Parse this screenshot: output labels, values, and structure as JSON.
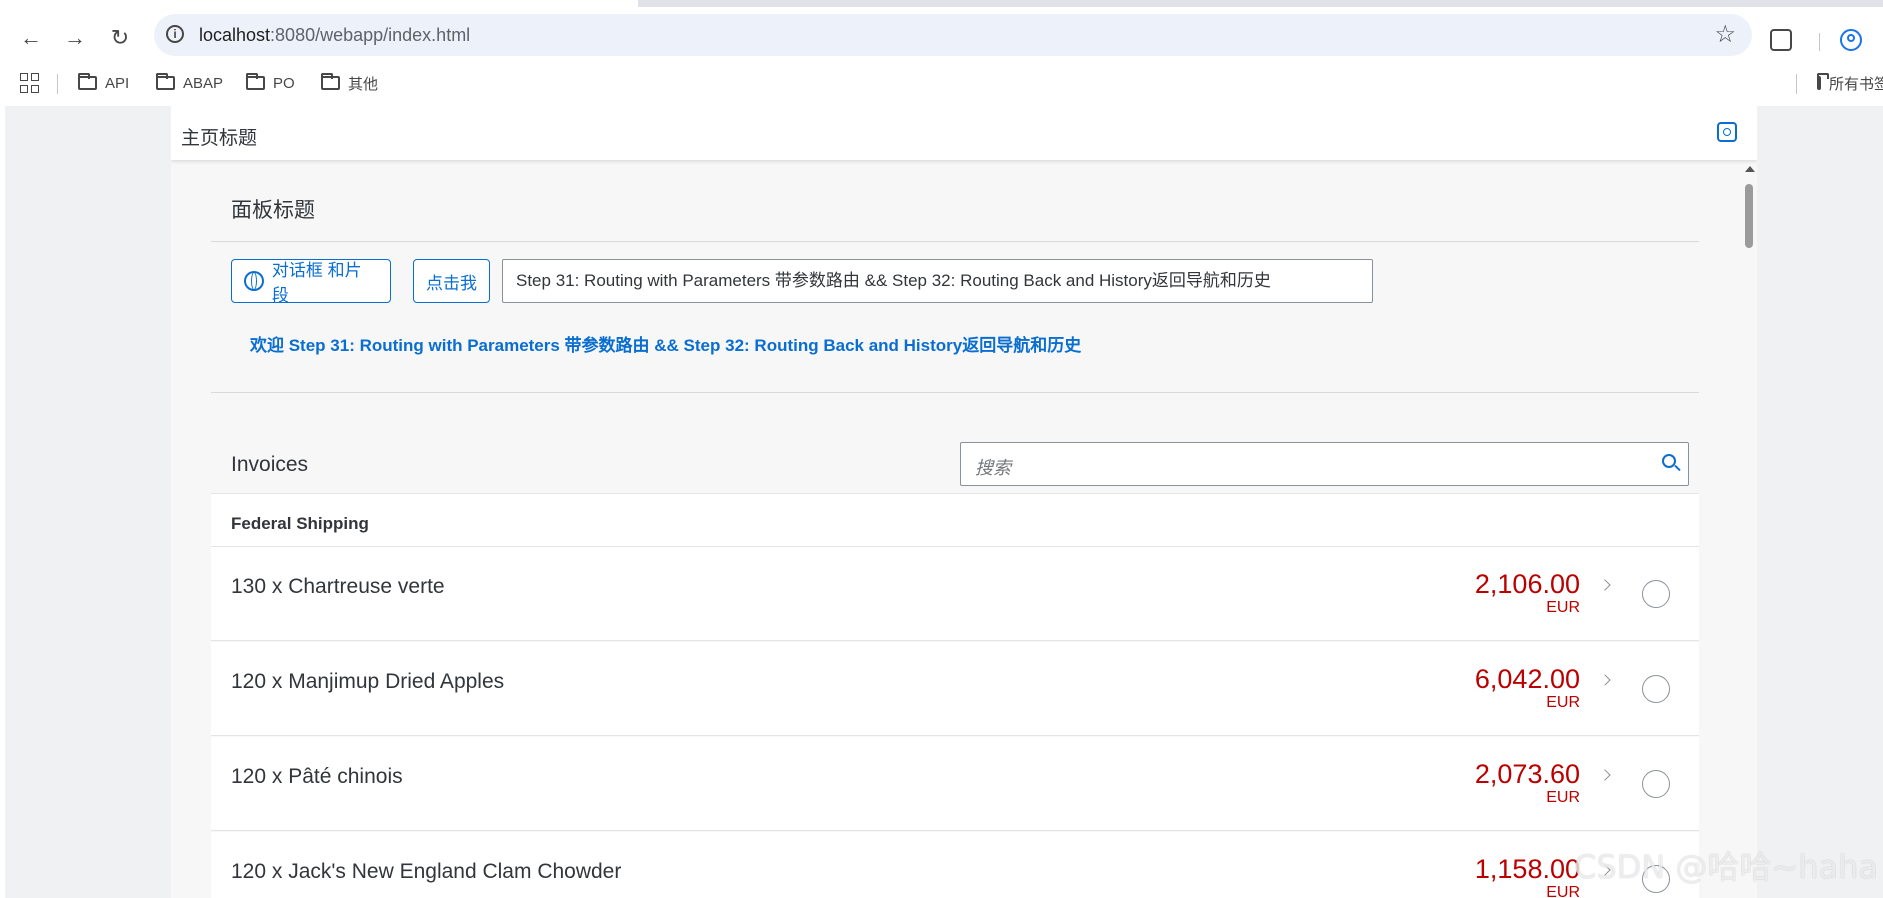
{
  "browser": {
    "url_host": "localhost",
    "url_path": ":8080/webapp/index.html",
    "bookmarks": [
      "API",
      "ABAP",
      "PO",
      "其他"
    ],
    "bookmarks_right": "所有书签"
  },
  "shell": {
    "title": "主页标题"
  },
  "panel": {
    "title": "面板标题",
    "dialog_button_label": "对话框 和片段",
    "click_button_label": "点击我",
    "name_input_value": "Step 31: Routing with Parameters 带参数路由 && Step 32: Routing Back and History返回导航和历史",
    "greeting": "欢迎 Step 31: Routing with Parameters 带参数路由 && Step 32: Routing Back and History返回导航和历史"
  },
  "invoices": {
    "title": "Invoices",
    "search_placeholder": "搜索",
    "group": "Federal Shipping",
    "items": [
      {
        "title": "130 x Chartreuse verte",
        "amount": "2,106.00",
        "currency": "EUR"
      },
      {
        "title": "120 x Manjimup Dried Apples",
        "amount": "6,042.00",
        "currency": "EUR"
      },
      {
        "title": "120 x Pâté chinois",
        "amount": "2,073.60",
        "currency": "EUR"
      },
      {
        "title": "120 x Jack's New England Clam Chowder",
        "amount": "1,158.00",
        "currency": "EUR"
      }
    ],
    "amount_color": "#bb0000"
  },
  "watermark": "CSDN @哈哈~haha"
}
